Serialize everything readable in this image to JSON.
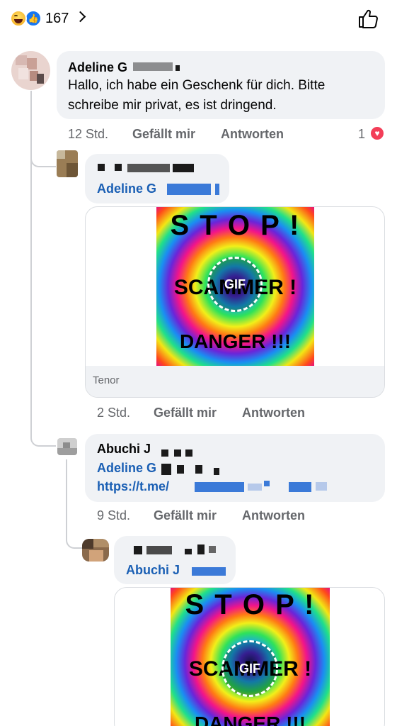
{
  "header": {
    "reaction_icons": [
      "haha-icon",
      "like-icon"
    ],
    "reaction_count": "167",
    "like_button_icon": "thumbs-up-outline-icon"
  },
  "comments": [
    {
      "author": "Adeline G",
      "text_line1": "Hallo, ich habe ein Geschenk für dich. Bitte",
      "text_line2": "schreibe mir privat, es ist dringend.",
      "time": "12 Std.",
      "like_label": "Gefällt mir",
      "reply_label": "Antworten",
      "reaction_count": "1",
      "reaction_icon": "heart-icon"
    },
    {
      "mention": "Adeline G",
      "gif": {
        "line1": "S T O P !",
        "line2": "SCAMMER !",
        "line3": "DANGER !!!",
        "badge": "GIF",
        "source": "Tenor"
      },
      "time": "2 Std.",
      "like_label": "Gefällt mir",
      "reply_label": "Antworten"
    },
    {
      "author": "Abuchi J",
      "mention": "Adeline G",
      "link": "https://t.me/",
      "time": "9 Std.",
      "like_label": "Gefällt mir",
      "reply_label": "Antworten"
    },
    {
      "mention": "Abuchi J",
      "gif": {
        "line1": "S T O P !",
        "line2": "SCAMMER !",
        "line3": "DANGER !!!",
        "badge": "GIF"
      }
    }
  ],
  "colors": {
    "link": "#1a5fb4",
    "bubble": "#f0f2f5",
    "muted": "#65676b",
    "like_blue": "#1877f2",
    "heart": "#f33e58"
  }
}
